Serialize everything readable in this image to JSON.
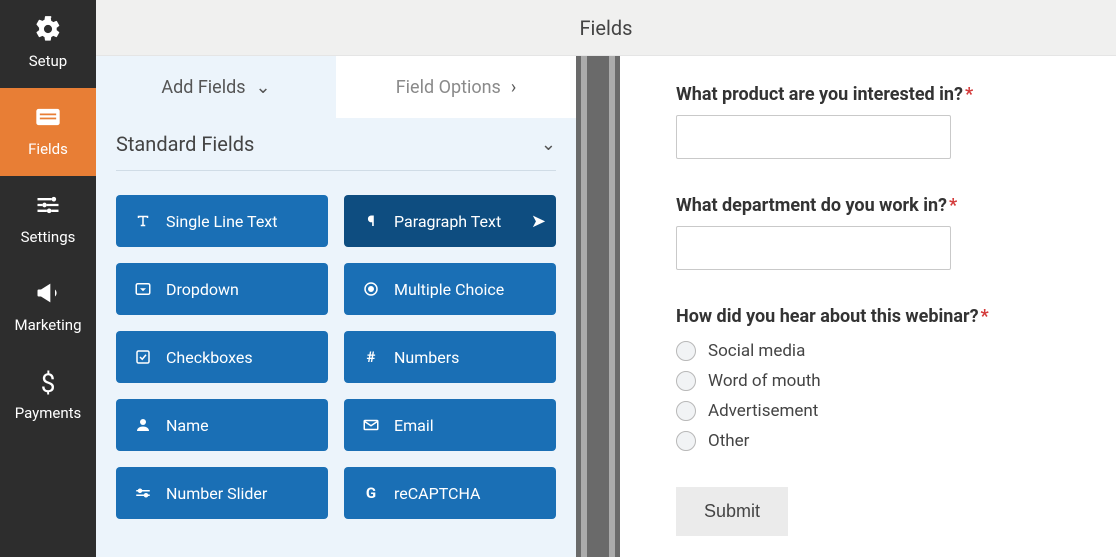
{
  "header": {
    "title": "Fields"
  },
  "sidebar": {
    "items": [
      {
        "label": "Setup",
        "icon": "gear-icon"
      },
      {
        "label": "Fields",
        "icon": "form-icon",
        "active": true
      },
      {
        "label": "Settings",
        "icon": "sliders-icon"
      },
      {
        "label": "Marketing",
        "icon": "megaphone-icon"
      },
      {
        "label": "Payments",
        "icon": "dollar-icon"
      }
    ]
  },
  "panel": {
    "tabs": {
      "add_label": "Add Fields",
      "options_label": "Field Options"
    },
    "section_title": "Standard Fields",
    "fields": [
      {
        "label": "Single Line Text",
        "icon": "text-type-icon"
      },
      {
        "label": "Paragraph Text",
        "icon": "paragraph-icon",
        "hovered": true
      },
      {
        "label": "Dropdown",
        "icon": "dropdown-icon"
      },
      {
        "label": "Multiple Choice",
        "icon": "radio-icon"
      },
      {
        "label": "Checkboxes",
        "icon": "checkbox-icon"
      },
      {
        "label": "Numbers",
        "icon": "hash-icon"
      },
      {
        "label": "Name",
        "icon": "person-icon"
      },
      {
        "label": "Email",
        "icon": "envelope-icon"
      },
      {
        "label": "Number Slider",
        "icon": "slider-icon"
      },
      {
        "label": "reCAPTCHA",
        "icon": "google-icon"
      }
    ]
  },
  "preview": {
    "questions": [
      {
        "label": "What product are you interested in?",
        "required": true,
        "type": "text"
      },
      {
        "label": "What department do you work in?",
        "required": true,
        "type": "text"
      },
      {
        "label": "How did you hear about this webinar?",
        "required": true,
        "type": "radio",
        "options": [
          "Social media",
          "Word of mouth",
          "Advertisement",
          "Other"
        ]
      }
    ],
    "submit_label": "Submit"
  }
}
